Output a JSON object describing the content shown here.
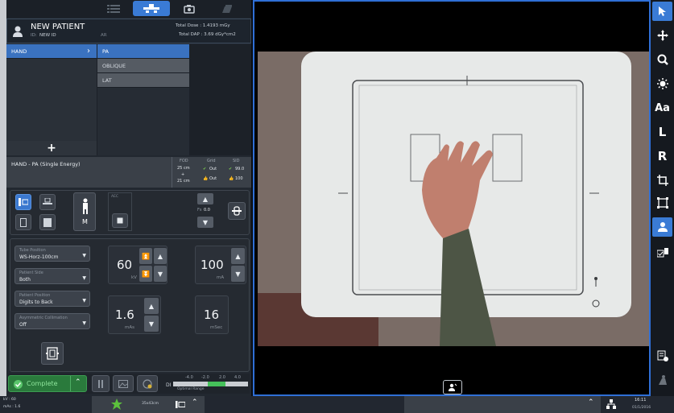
{
  "nav": {
    "tabs": [
      "list-icon",
      "scanner-icon",
      "camera-icon",
      "folder-icon"
    ],
    "active_index": 1
  },
  "patient": {
    "name": "NEW PATIENT",
    "id": "NEW ID",
    "id_prefix": "ID:",
    "age": "AR",
    "total_dose": "Total Dose : 1.4193 mGy",
    "total_dap": "Total DAP : 3.69 dGy*cm2"
  },
  "body_parts": [
    {
      "label": "HAND",
      "selected": true
    }
  ],
  "views": [
    {
      "label": "PA",
      "selected": true
    },
    {
      "label": "OBLIQUE"
    },
    {
      "label": "LAT"
    }
  ],
  "add_label": "+",
  "exam": {
    "title": "HAND - PA (Single Energy)",
    "fod_label": "FOD",
    "fod_value": "25 cm",
    "fod_sep": "+",
    "fod_value2": "21 cm",
    "grid_label": "Grid",
    "grid_out1": "Out",
    "grid_out2": "Out",
    "sid_label": "SID",
    "sid_val1": "99.0",
    "sid_val2": "100"
  },
  "controls": {
    "aec": "AEC",
    "patient_size": "M",
    "focal": "0.0",
    "focal_prefix": "Fs",
    "tube_position": {
      "label": "Tube Position",
      "value": "WS-Horz-100cm"
    },
    "patient_side": {
      "label": "Patient Side",
      "value": "Both"
    },
    "patient_position": {
      "label": "Patient Position",
      "value": "Digits to Back"
    },
    "collimation": {
      "label": "Asymmetric Collimation",
      "value": "Off"
    },
    "kv": {
      "value": "60",
      "unit": "kV"
    },
    "ma": {
      "value": "100",
      "unit": "mA"
    },
    "mas": {
      "value": "1.6",
      "unit": "mAs"
    },
    "msec": {
      "value": "16",
      "unit": "mSec"
    }
  },
  "bottom": {
    "complete_label": "Complete",
    "di_label": "DI",
    "di_ticks": [
      "-4.0",
      "-2.0",
      "2.0",
      "4.0"
    ],
    "di_caption": "Optimal Range"
  },
  "viewer": {
    "mark_right_icon": "person-icon",
    "mark_bottom_icon": "scan-icon"
  },
  "right_tools": [
    "pointer-icon",
    "move-icon",
    "zoom-icon",
    "brightness-icon",
    "Aa",
    "L",
    "R",
    "crop-icon",
    "collimate-icon",
    "patient-icon",
    "settings-icon",
    "stitch-icon",
    "exit-icon"
  ],
  "taskbar": {
    "left1": "kV : 60",
    "left2": "mAs : 1.6",
    "exam_short": "35x43cm",
    "time": "16:11",
    "date": "01/1/2016"
  },
  "colors": {
    "accent": "#3a7bd5",
    "green": "#2fa84f"
  }
}
